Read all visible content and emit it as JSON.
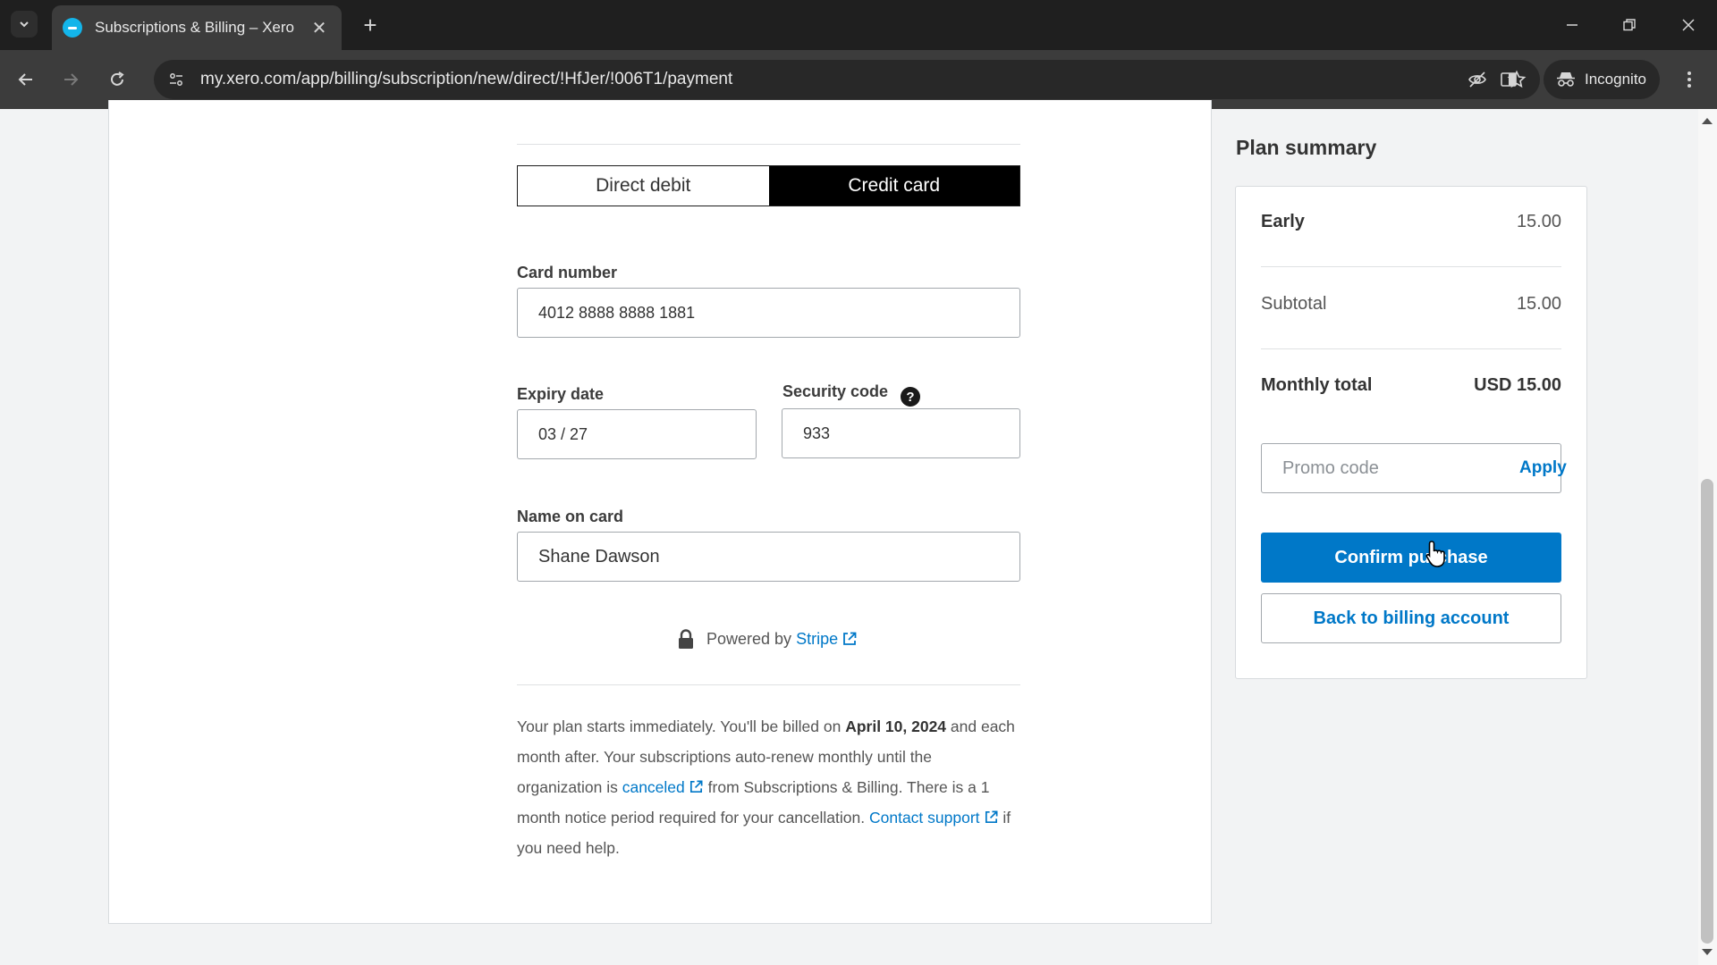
{
  "browser": {
    "tab_title": "Subscriptions & Billing – Xero",
    "url": "my.xero.com/app/billing/subscription/new/direct/!HfJer/!006T1/payment",
    "incognito_label": "Incognito"
  },
  "payment": {
    "methods": [
      {
        "label": "Direct debit",
        "selected": false
      },
      {
        "label": "Credit card",
        "selected": true
      }
    ],
    "card_number_label": "Card number",
    "card_number_value": "4012 8888 8888 1881",
    "expiry_label": "Expiry date",
    "expiry_value": "03 / 27",
    "security_label": "Security code",
    "security_value": "933",
    "name_label": "Name on card",
    "name_value": "Shane Dawson",
    "powered_by_text": "Powered by",
    "powered_by_link": "Stripe"
  },
  "terms": {
    "part1": "Your plan starts immediately. You'll be billed on ",
    "date": "April 10, 2024",
    "part2": " and each month after. Your subscriptions auto-renew monthly until the organization is ",
    "canceled_link": "canceled",
    "part3": " from Subscriptions & Billing. There is a 1 month notice period required for your cancellation. ",
    "support_link": "Contact support",
    "part4": " if you need help."
  },
  "summary": {
    "title": "Plan summary",
    "plan_name": "Early",
    "plan_price": "15.00",
    "subtotal_label": "Subtotal",
    "subtotal_value": "15.00",
    "total_label": "Monthly total",
    "total_value": "USD 15.00",
    "promo_placeholder": "Promo code",
    "apply_label": "Apply",
    "confirm_label": "Confirm purchase",
    "back_label": "Back to billing account"
  },
  "colors": {
    "accent": "#0078c8",
    "selected_segment": "#000000",
    "favicon": "#13b5ea"
  }
}
